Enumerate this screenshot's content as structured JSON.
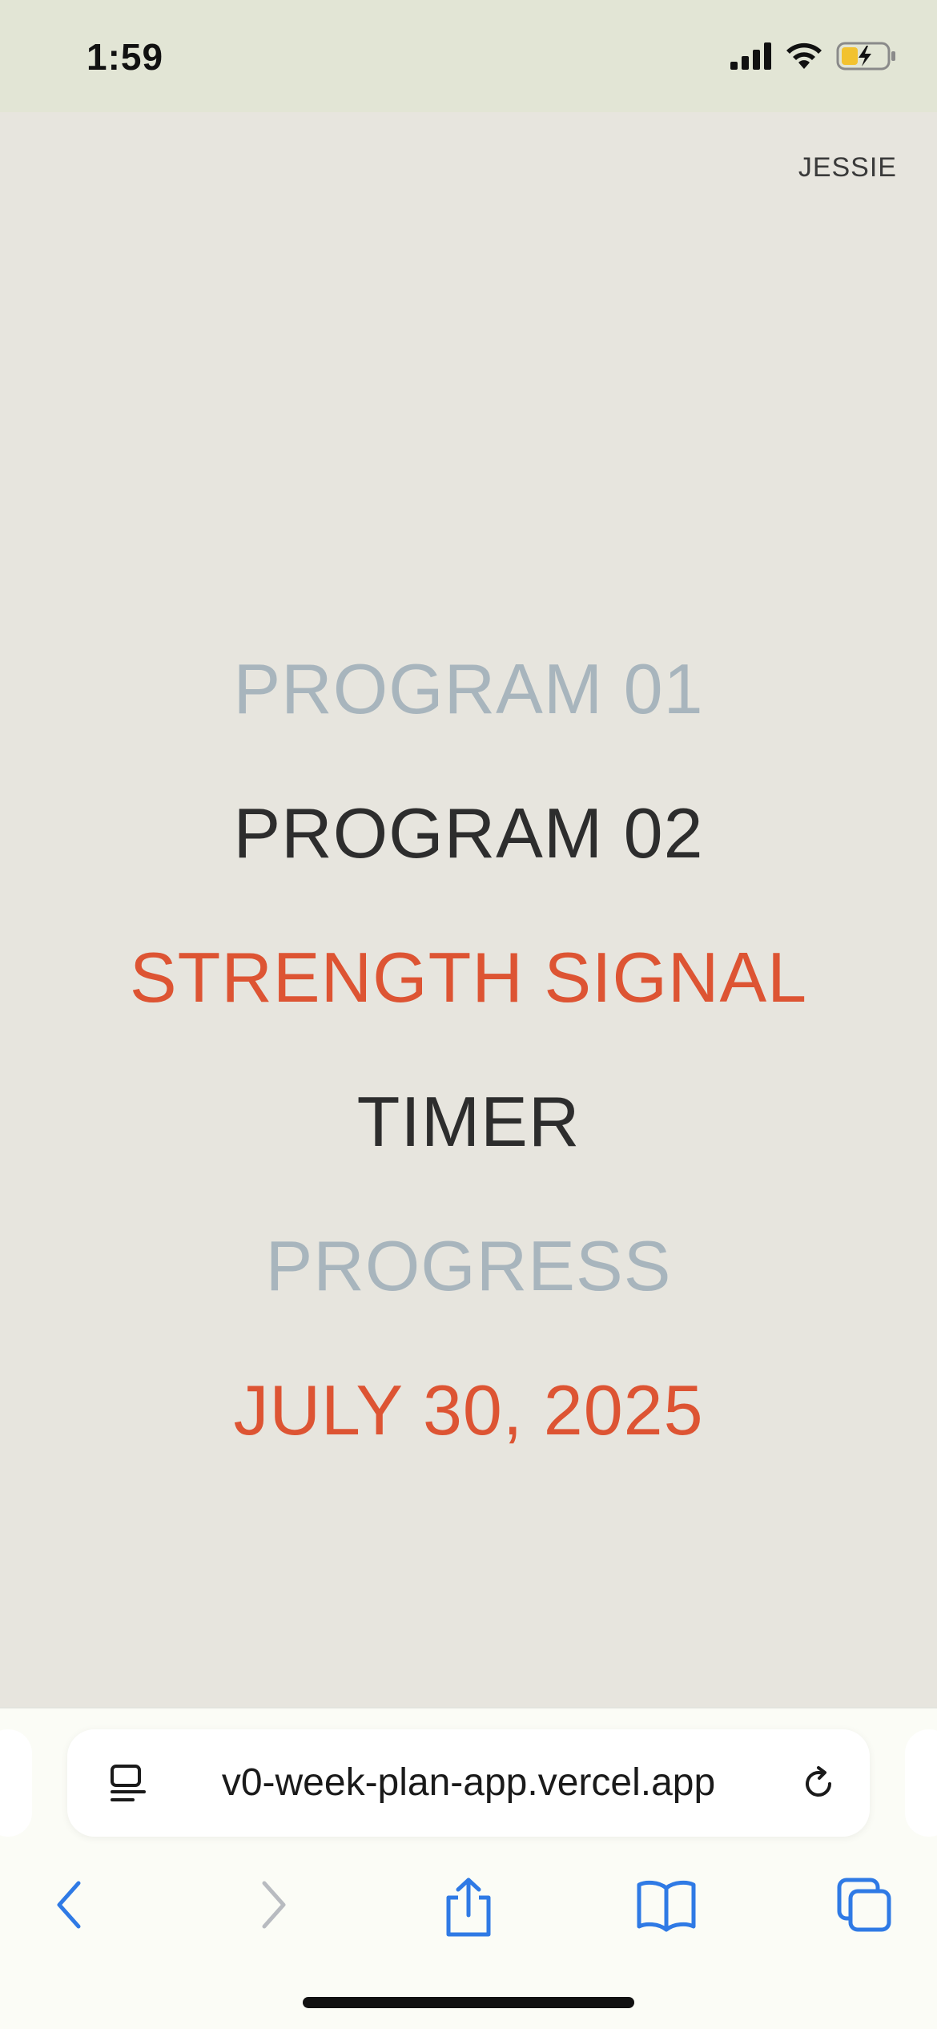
{
  "status_bar": {
    "time": "1:59",
    "icons": [
      "cellular-signal-icon",
      "wifi-icon",
      "battery-charging-icon"
    ]
  },
  "app": {
    "user_name": "JESSIE",
    "menu": [
      {
        "label": "PROGRAM 01",
        "color": "#a8b5bd"
      },
      {
        "label": "PROGRAM 02",
        "color": "#2d2d2d"
      },
      {
        "label": "STRENGTH SIGNAL",
        "color": "#dd5433"
      },
      {
        "label": "TIMER",
        "color": "#2d2d2d"
      },
      {
        "label": "PROGRESS",
        "color": "#a8b5bd"
      }
    ],
    "date": "JULY 30, 2025",
    "colors": {
      "background": "#e7e5de",
      "accent": "#dd5433",
      "muted": "#a8b5bd",
      "text": "#2d2d2d"
    }
  },
  "browser": {
    "url": "v0-week-plan-app.vercel.app",
    "toolbar_icons": [
      "back-icon",
      "forward-icon",
      "share-icon",
      "bookmarks-icon",
      "tabs-icon"
    ]
  }
}
